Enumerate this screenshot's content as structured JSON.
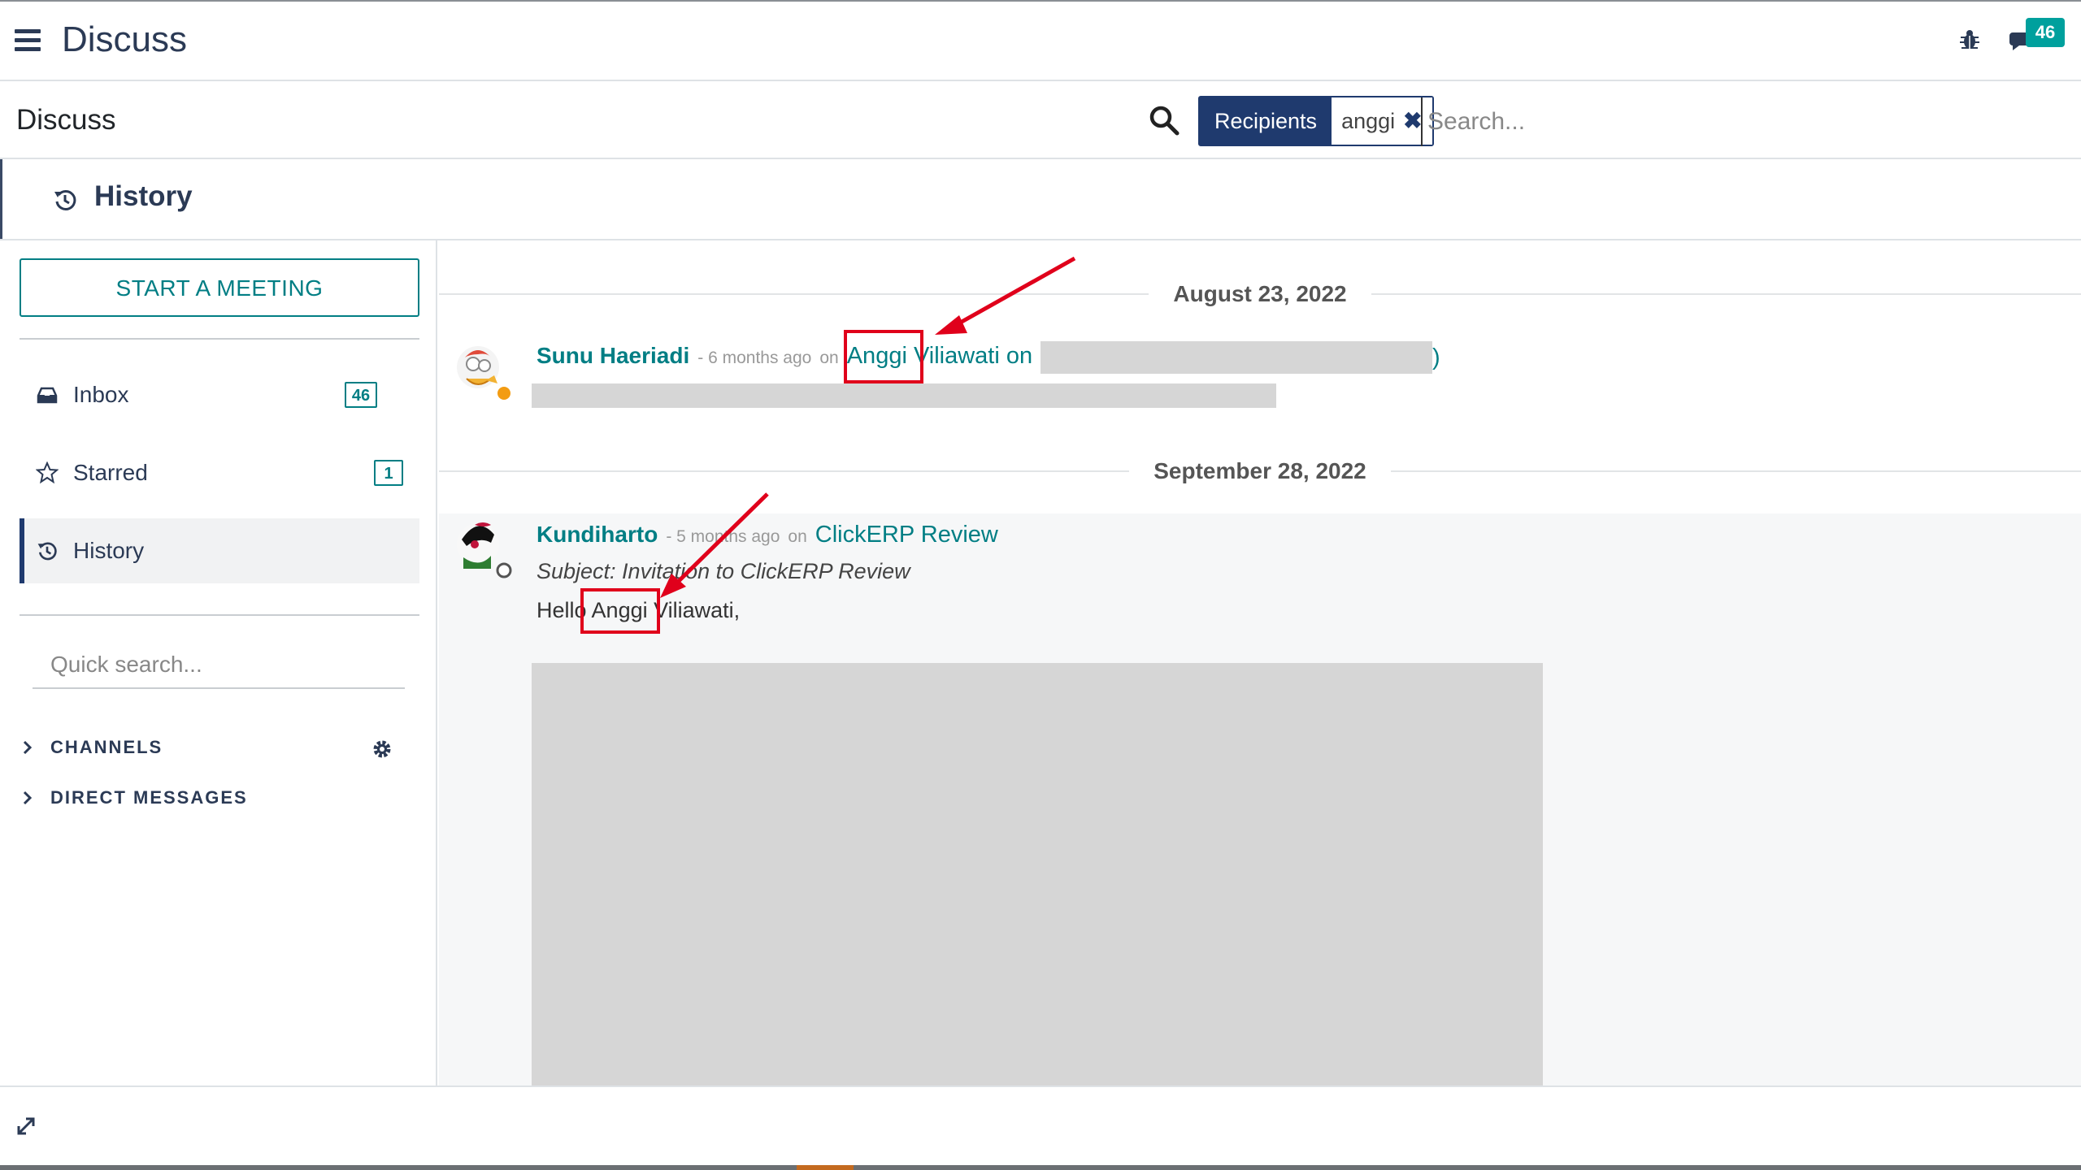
{
  "app": {
    "title": "Discuss",
    "notification_count": "46"
  },
  "control_panel": {
    "breadcrumb": "Discuss",
    "facet": {
      "label": "Recipients",
      "value": "anggi"
    },
    "search": {
      "placeholder": "Search..."
    }
  },
  "history_header": {
    "title": "History"
  },
  "sidebar": {
    "start_meeting": "START A MEETING",
    "items": [
      {
        "label": "Inbox",
        "badge": "46",
        "icon": "inbox-icon"
      },
      {
        "label": "Starred",
        "badge": "1",
        "icon": "star-icon"
      },
      {
        "label": "History",
        "badge": "",
        "icon": "history-icon",
        "active": true
      }
    ],
    "quick_search_placeholder": "Quick search...",
    "sections": [
      {
        "label": "CHANNELS"
      },
      {
        "label": "DIRECT MESSAGES"
      }
    ]
  },
  "thread": {
    "groups": [
      {
        "date": "August 23, 2022",
        "message": {
          "author": "Sunu Haeriadi",
          "time": "- 6 months ago",
          "on": "on",
          "record": "Anggi Viliawati on",
          "record_tail": ")"
        }
      },
      {
        "date": "September 28, 2022",
        "message": {
          "author": "Kundiharto",
          "time": "- 5 months ago",
          "on": "on",
          "record": "ClickERP Review",
          "subject": "Subject: Invitation to ClickERP Review",
          "body": "Hello Anggi Viliawati,"
        }
      }
    ]
  },
  "colors": {
    "accent": "#017e84",
    "navy": "#1f3a6e",
    "annotation_red": "#e0001b",
    "badge_teal": "#00a09d"
  }
}
